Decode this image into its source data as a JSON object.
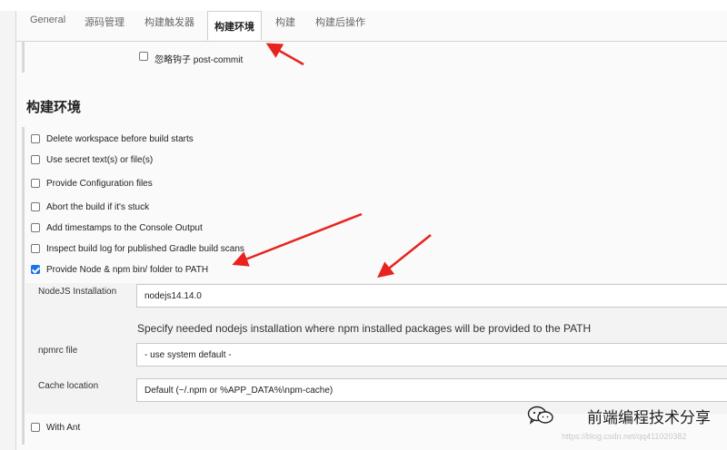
{
  "tabs": [
    {
      "label": "General",
      "active": false
    },
    {
      "label": "源码管理",
      "active": false
    },
    {
      "label": "构建触发器",
      "active": false
    },
    {
      "label": "构建环境",
      "active": true
    },
    {
      "label": "构建",
      "active": false
    },
    {
      "label": "构建后操作",
      "active": false
    }
  ],
  "triggers": {
    "ignore_post_commit": {
      "label": "忽略钩子 post-commit",
      "checked": false
    }
  },
  "build_env": {
    "title": "构建环境",
    "options": [
      {
        "label": "Delete workspace before build starts",
        "checked": false
      },
      {
        "label": "Use secret text(s) or file(s)",
        "checked": false
      },
      {
        "label": "Provide Configuration files",
        "checked": false
      },
      {
        "label": "Abort the build if it's stuck",
        "checked": false
      },
      {
        "label": "Add timestamps to the Console Output",
        "checked": false
      },
      {
        "label": "Inspect build log for published Gradle build scans",
        "checked": false
      },
      {
        "label": "Provide Node & npm bin/ folder to PATH",
        "checked": true
      }
    ],
    "node": {
      "installation_label": "NodeJS Installation",
      "installation_value": "nodejs14.14.0",
      "installation_help": "Specify needed nodejs installation where npm installed packages will be provided to the PATH",
      "npmrc_label": "npmrc file",
      "npmrc_value": "- use system default -",
      "cache_label": "Cache location",
      "cache_value": "Default (~/.npm or %APP_DATA%\\npm-cache)"
    },
    "with_ant": {
      "label": "With Ant",
      "checked": false
    }
  },
  "overlay": {
    "watermark": "前端编程技术分享",
    "url": "https://blog.csdn.net/qq411020382",
    "wechat_icon": "wechat-icon",
    "annotation_color": "#e8231f"
  }
}
